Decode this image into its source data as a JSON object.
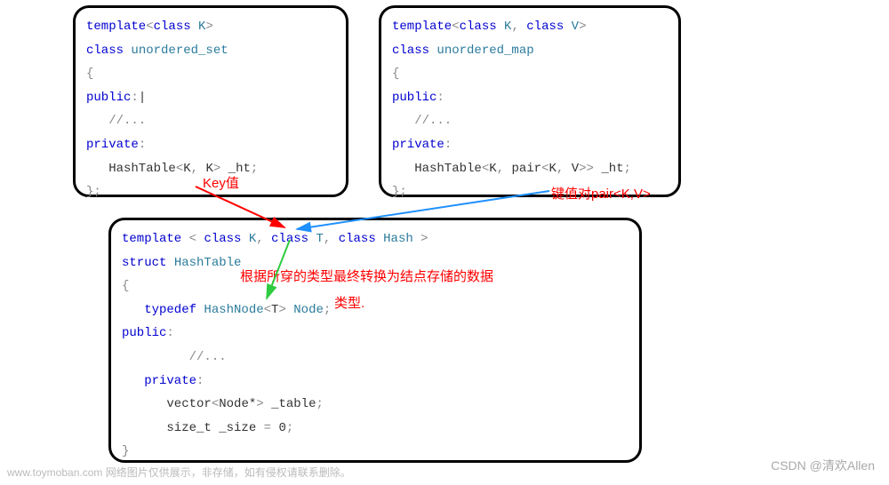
{
  "box1": {
    "l1_kw1": "template",
    "l1_sym1": "<",
    "l1_kw2": "class",
    "l1_typ1": " K",
    "l1_sym2": ">",
    "l2_kw1": "class",
    "l2_typ1": " unordered_set",
    "l3": "{",
    "l4_kw1": "public",
    "l4_sym1": ":",
    "l4_cursor": "|",
    "l5": "   //...",
    "l6_kw1": "private",
    "l6_sym1": ":",
    "l7_pre": "   HashTable",
    "l7_sym1": "<",
    "l7_a": "K",
    "l7_sym2": ", ",
    "l7_b": "K",
    "l7_sym3": "> ",
    "l7_var": "_ht",
    "l7_sym4": ";",
    "l8": "};"
  },
  "box2": {
    "l1_kw1": "template",
    "l1_sym1": "<",
    "l1_kw2": "class",
    "l1_typ1": " K",
    "l1_sym2": ", ",
    "l1_kw3": "class",
    "l1_typ2": " V",
    "l1_sym3": ">",
    "l2_kw1": "class",
    "l2_typ1": " unordered_map",
    "l3": "{",
    "l4_kw1": "public",
    "l4_sym1": ":",
    "l5": "   //...",
    "l6_kw1": "private",
    "l6_sym1": ":",
    "l7_pre": "   HashTable",
    "l7_sym1": "<",
    "l7_a": "K",
    "l7_sym2": ", ",
    "l7_b": "pair",
    "l7_sym3": "<",
    "l7_c": "K",
    "l7_sym4": ", ",
    "l7_d": "V",
    "l7_sym5": ">> ",
    "l7_var": "_ht",
    "l7_sym6": ";",
    "l8": "};"
  },
  "box3": {
    "l1_kw1": "template",
    "l1_sym1": " < ",
    "l1_kw2": "class",
    "l1_typ1": " K",
    "l1_sym2": ", ",
    "l1_kw3": "class",
    "l1_typ2": " T",
    "l1_sym3": ", ",
    "l1_kw4": "class",
    "l1_typ3": " Hash",
    "l1_sym4": " >",
    "l2_kw1": "struct",
    "l2_typ1": " HashTable",
    "l3": "{",
    "l4_kw1": "   typedef",
    "l4_typ1": " HashNode",
    "l4_sym1": "<",
    "l4_a": "T",
    "l4_sym2": "> ",
    "l4_typ2": "Node",
    "l4_sym3": ";",
    "l5_kw1": "public",
    "l5_sym1": ":",
    "l6": "         //...",
    "l7_kw1": "   private",
    "l7_sym1": ":",
    "l8_pre": "      vector",
    "l8_sym1": "<",
    "l8_a": "Node*",
    "l8_sym2": "> ",
    "l8_var": "_table",
    "l8_sym3": ";",
    "l9_pre": "      size_t ",
    "l9_var": "_size",
    "l9_sym1": " = ",
    "l9_val": "0",
    "l9_sym2": ";",
    "l10": "}"
  },
  "annotations": {
    "key_label": "Key值",
    "pair_label": "键值对pair<K,V>",
    "note": "根据所穿的类型最终转换为结点存储的数据",
    "type_label": "类型."
  },
  "watermark": {
    "left": "www.toymoban.com 网络图片仅供展示，非存储，如有侵权请联系删除。",
    "right": "CSDN @清欢Allen"
  }
}
